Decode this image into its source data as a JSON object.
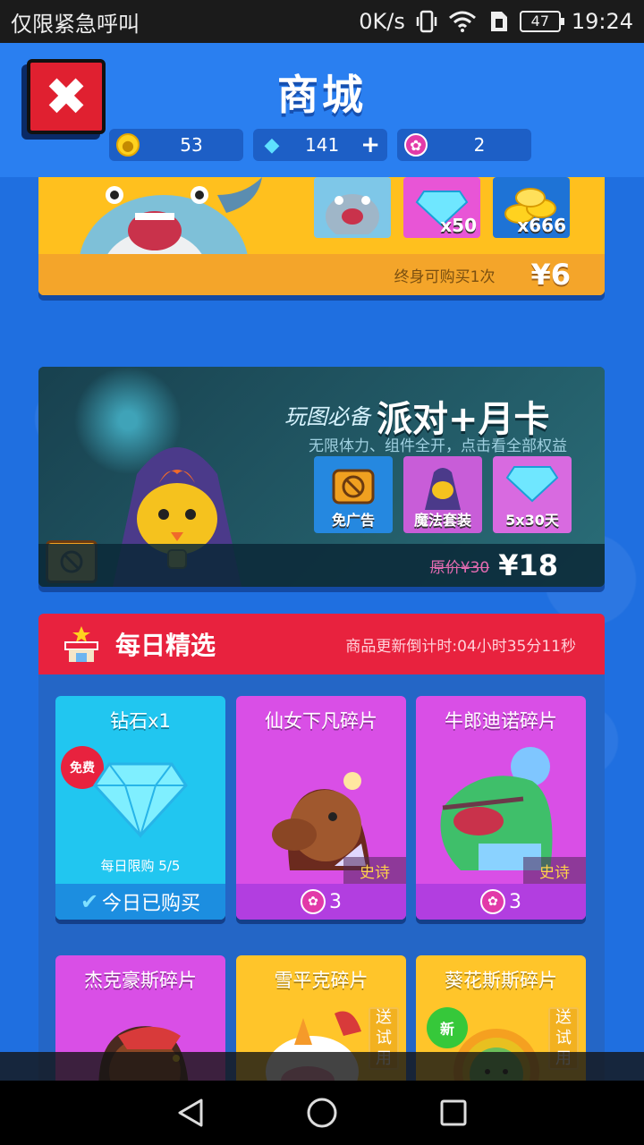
{
  "status_bar": {
    "left_text": "仅限紧急呼叫",
    "net_speed": "0K/s",
    "battery": "47",
    "time": "19:24"
  },
  "header": {
    "title": "商城",
    "close_icon": "close-icon"
  },
  "currency": {
    "coins": "53",
    "gems": "141",
    "gems_plus": "+",
    "lotus": "2"
  },
  "pack1": {
    "items": [
      {
        "name": "shark-character",
        "label": ""
      },
      {
        "name": "gem-stack",
        "label": "x50"
      },
      {
        "name": "coin-pile",
        "label": "x666"
      }
    ],
    "note": "终身可购买1次",
    "price": "¥6"
  },
  "pack2": {
    "slogan": "玩图必备",
    "title": "派对+月卡",
    "subtitle": "无限体力、组件全开，点击看全部权益",
    "items": [
      {
        "label": "免广告"
      },
      {
        "label": "魔法套装"
      },
      {
        "label": "5x30天"
      }
    ],
    "original_price": "原价¥30",
    "price": "¥18"
  },
  "daily": {
    "title": "每日精选",
    "timer": "商品更新倒计时:04小时35分11秒",
    "tiles": [
      {
        "name": "钻石x1",
        "badge": "免费",
        "limit": "每日限购 5/5",
        "footer": "今日已购买"
      },
      {
        "name": "仙女下凡碎片",
        "tag": "史诗",
        "price": "3"
      },
      {
        "name": "牛郎迪诺碎片",
        "tag": "史诗",
        "price": "3"
      },
      {
        "name": "杰克豪斯碎片"
      },
      {
        "name": "雪平克碎片",
        "trial": "送试用"
      },
      {
        "name": "葵花斯斯碎片",
        "badge": "新",
        "trial": "送试用"
      }
    ]
  },
  "colors": {
    "bg": "#1f6fe0",
    "header_red": "#e8223e",
    "gold": "#ffc01e",
    "magenta": "#d94fe6",
    "cyan": "#21c6f0"
  }
}
